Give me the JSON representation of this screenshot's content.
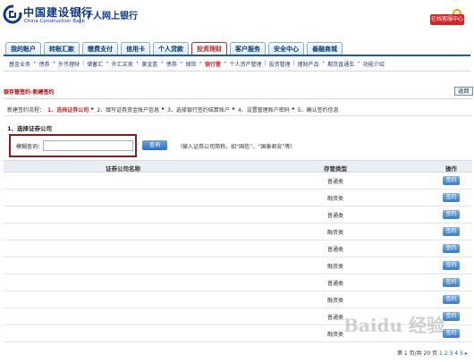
{
  "header": {
    "bank_name_cn": "中国建设银行",
    "bank_name_en": "China Construction Bank",
    "site_title": "个人网上银行",
    "customer_service": "在线客服中心"
  },
  "nav": {
    "tabs": [
      "我的账户",
      "转账汇款",
      "缴费支付",
      "信用卡",
      "个人贷款",
      "投资理财",
      "客户服务",
      "安全中心",
      "善融商城"
    ],
    "active": "投资理财"
  },
  "subnav": {
    "items": [
      "基金业务",
      "债券",
      "外币理财",
      "储蓄汇",
      "外汇买卖",
      "黄金篮",
      "债券",
      "保险",
      "银行管",
      "个人资产管理",
      "投资管理",
      "理财产品",
      "期货直通车",
      "功能介绍"
    ],
    "active": "银行管"
  },
  "breadcrumb": "银存管签约-新建签约",
  "back_button": "返回",
  "process": {
    "label": "新建签约流程：",
    "steps": [
      "1、选择证券公司",
      "2、填写证券资金账户信息",
      "3、选择银行签约结算账户",
      "4、设置管理账户密码",
      "5、确认签约信息"
    ],
    "current": 0
  },
  "section_title": "1、选择证券公司",
  "search": {
    "label": "模糊查询：",
    "value": "",
    "button": "查询",
    "hint": "（输入证券公司简称，如“国信”、“国泰君安”等）"
  },
  "table": {
    "headers": {
      "name": "证券公司名称",
      "type": "存管类型",
      "op": "操作"
    },
    "rows": [
      {
        "type": "普通类",
        "action": "签约"
      },
      {
        "type": "融资类",
        "action": "签约"
      },
      {
        "type": "普通类",
        "action": "签约"
      },
      {
        "type": "融资类",
        "action": "签约"
      },
      {
        "type": "普通类",
        "action": "签约"
      },
      {
        "type": "融资类",
        "action": "签约"
      },
      {
        "type": "普通类",
        "action": "签约"
      },
      {
        "type": "融资类",
        "action": "签约"
      },
      {
        "type": "普通类",
        "action": "签约"
      },
      {
        "type": "融资类",
        "action": "签约"
      }
    ]
  },
  "pager": {
    "text": "第 1 页/共 20 页",
    "pages": [
      "1",
      "2",
      "3",
      "4",
      "5",
      "▸"
    ]
  },
  "watermark": "Baidu 经验"
}
